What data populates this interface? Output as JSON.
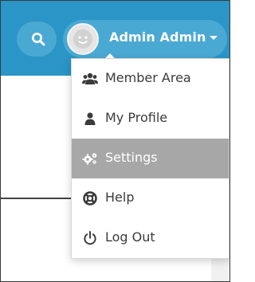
{
  "header": {
    "search_icon": "search-icon",
    "user_name": "Admin Admin",
    "avatar_icon": "default-avatar-icon",
    "dropdown_icon": "caret-down-icon",
    "background_color": "#2a95c6",
    "pill_color": "#4aa9d3"
  },
  "user_menu": {
    "active_color": "#a7a7a7",
    "items": [
      {
        "label": "Member Area",
        "icon": "users-icon",
        "active": false
      },
      {
        "label": "My Profile",
        "icon": "user-icon",
        "active": false
      },
      {
        "label": "Settings",
        "icon": "cogs-icon",
        "active": true
      },
      {
        "label": "Help",
        "icon": "life-ring-icon",
        "active": false
      },
      {
        "label": "Log Out",
        "icon": "power-icon",
        "active": false
      }
    ]
  }
}
